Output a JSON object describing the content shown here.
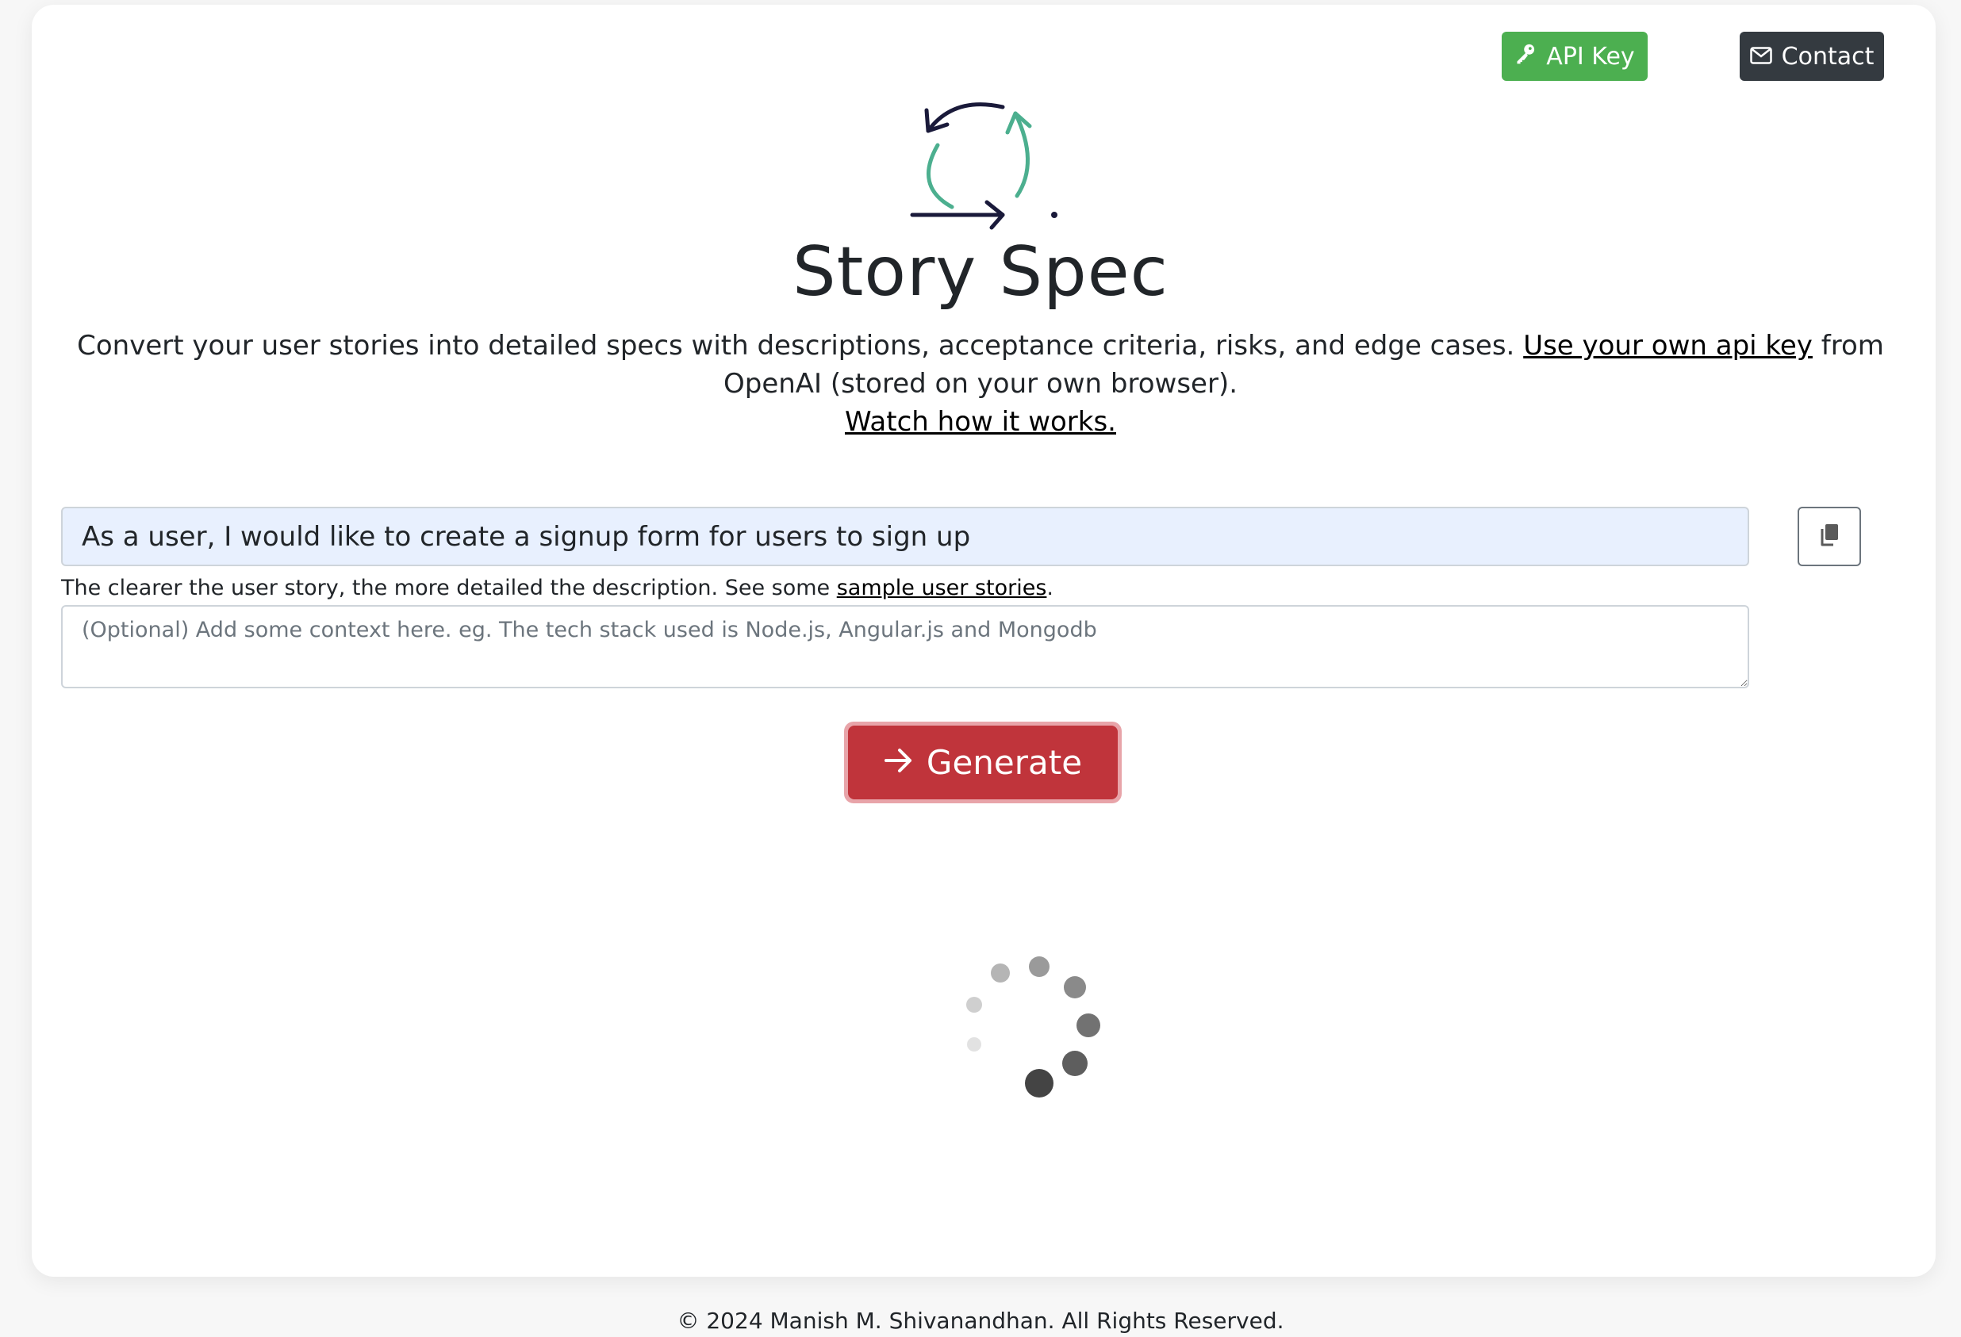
{
  "header": {
    "api_key_label": "API Key",
    "contact_label": "Contact"
  },
  "hero": {
    "title": "Story Spec",
    "description_prefix": "Convert your user stories into detailed specs with descriptions, acceptance criteria, risks, and edge cases. ",
    "api_key_link": "Use your own api key",
    "description_suffix": " from OpenAI (stored on your own browser).",
    "watch_link": "Watch how it works."
  },
  "form": {
    "story_value": "As a user, I would like to create a signup form for users to sign up",
    "hint_prefix": "The clearer the user story, the more detailed the description. See some ",
    "hint_link": "sample user stories",
    "hint_suffix": ".",
    "context_placeholder": "(Optional) Add some context here. eg. The tech stack used is Node.js, Angular.js and Mongodb",
    "generate_label": "Generate"
  },
  "footer": {
    "text": "© 2024 Manish M. Shivanandhan. All Rights Reserved."
  },
  "colors": {
    "api_key_bg": "#4caf50",
    "contact_bg": "#343a40",
    "generate_bg": "#c0343b",
    "logo_accent": "#4caf8f",
    "logo_dark": "#1a1a3a"
  },
  "icons": {
    "api_key": "key-icon",
    "contact": "envelope-icon",
    "copy": "copy-icon",
    "generate": "arrow-right-icon",
    "logo": "cycle-arrows-icon",
    "loading": "spinner-icon"
  }
}
